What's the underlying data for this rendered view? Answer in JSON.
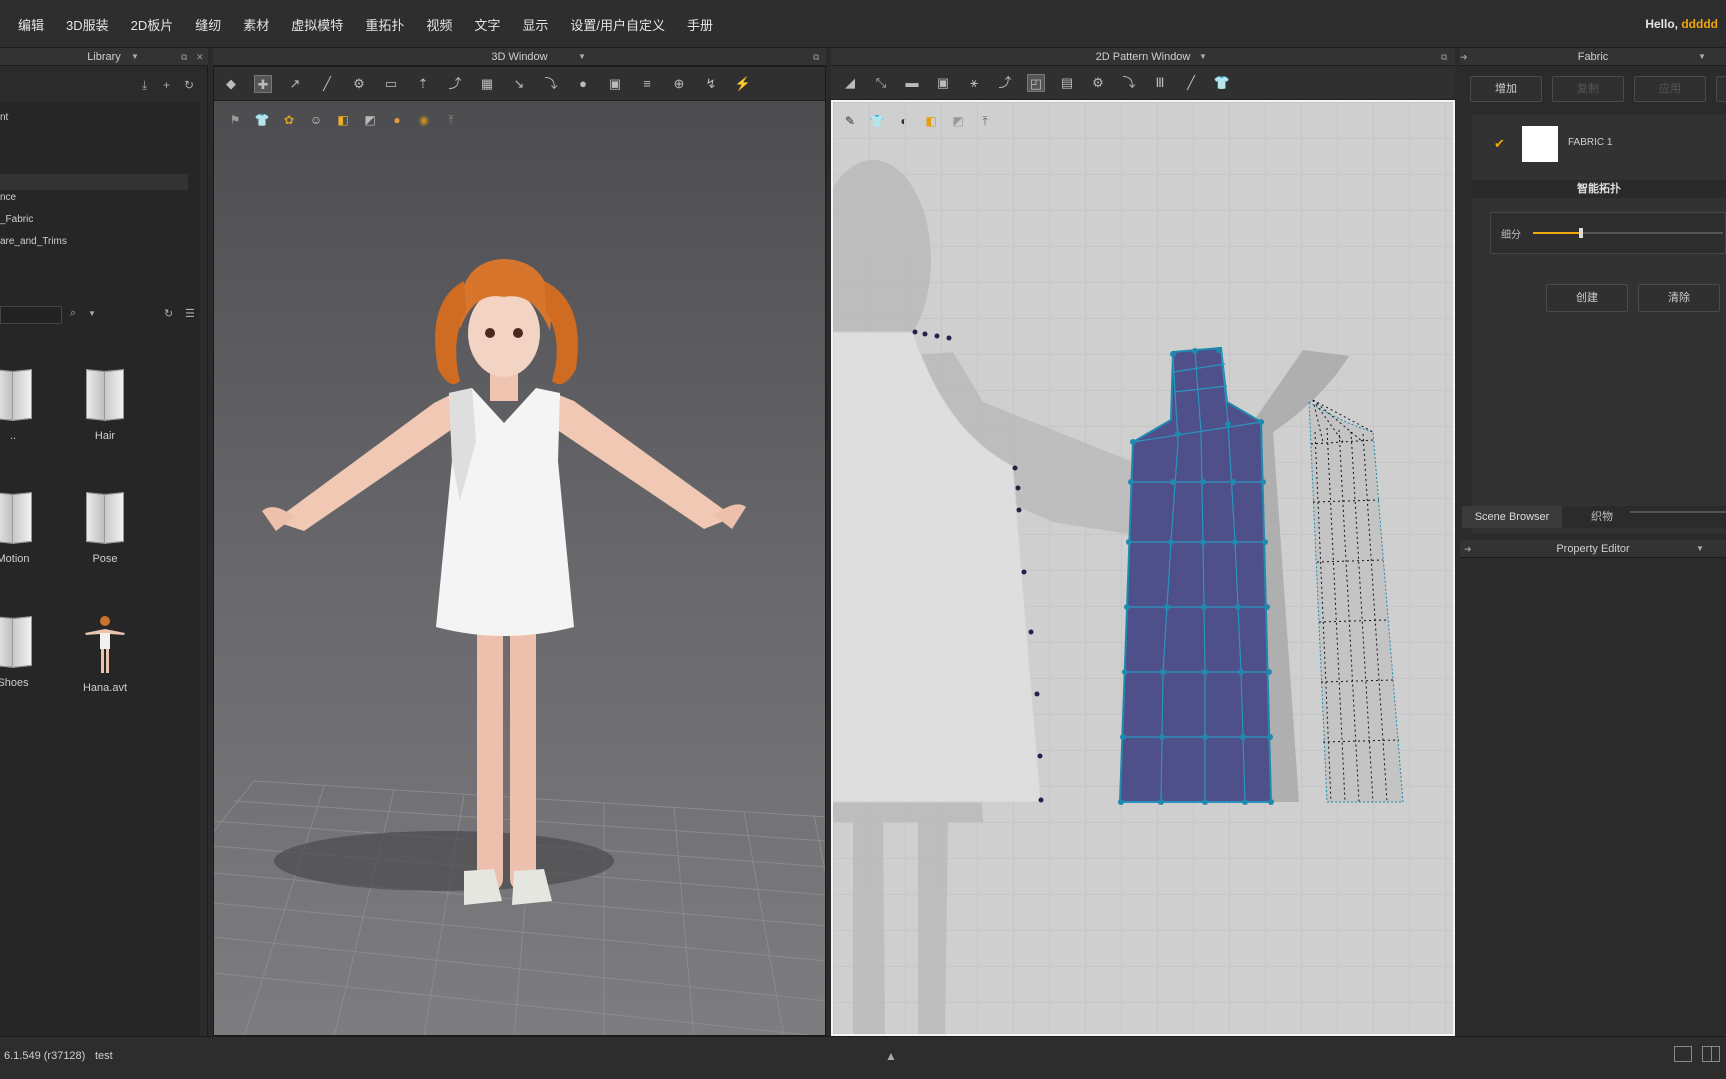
{
  "menu": {
    "items": [
      "编辑",
      "3D服装",
      "2D板片",
      "缝纫",
      "素材",
      "虚拟模特",
      "重拓扑",
      "视频",
      "文字",
      "显示",
      "设置/用户自定义",
      "手册"
    ],
    "greeting_prefix": "Hello,",
    "user_name": "ddddd"
  },
  "panels": {
    "library_title": "Library",
    "window3d_title": "3D Window",
    "window2d_title": "2D Pattern Window",
    "fabric_title": "Fabric"
  },
  "library": {
    "tree_rows": [
      "nt",
      "nce",
      "_Fabric",
      "are_and_Trims"
    ],
    "grid_items": [
      {
        "label": "..",
        "icon": "folder-icon"
      },
      {
        "label": "Hair",
        "icon": "folder-icon"
      },
      {
        "label": "Motion",
        "icon": "folder-icon"
      },
      {
        "label": "Pose",
        "icon": "folder-icon"
      },
      {
        "label": "Shoes",
        "icon": "folder-icon"
      },
      {
        "label": "Hana.avt",
        "icon": "avatar-thumbnail"
      }
    ]
  },
  "fabric": {
    "buttons": {
      "add": "增加",
      "copy": "复制",
      "apply": "应用"
    },
    "fabric_name": "FABRIC 1",
    "retopo_title": "智能拓扑",
    "subdivide_label": "细分",
    "subdivide_level": 0.25,
    "create_label": "创建",
    "clear_label": "清除"
  },
  "tabs": {
    "scene_browser": "Scene Browser",
    "fabric_tab": "织物"
  },
  "property_editor_title": "Property Editor",
  "status": {
    "version": "6.1.549 (r37128)",
    "project": "test"
  },
  "colors": {
    "accent": "#f0a80a",
    "pattern_fill": "#4f4f8a",
    "pattern_edge": "#1f8ab0"
  }
}
